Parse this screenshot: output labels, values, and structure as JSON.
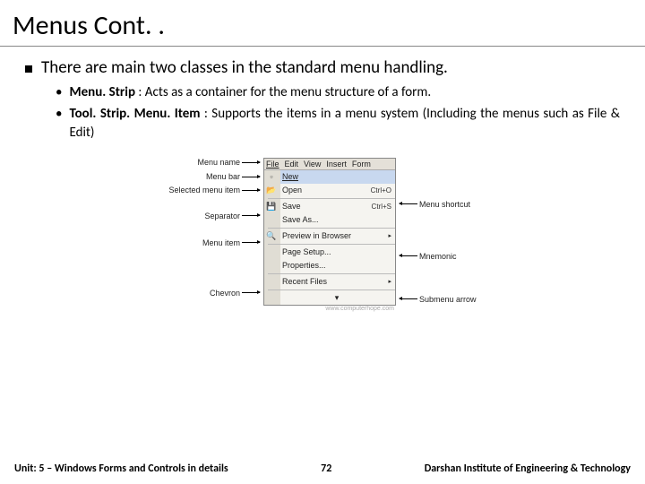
{
  "title": "Menus Cont. .",
  "bullet_main": "There are main two classes in the standard menu handling.",
  "sub1_bold": "Menu. Strip",
  "sub1_rest": " : Acts as a container for the menu structure of a form.",
  "sub2_bold": "Tool. Strip. Menu. Item",
  "sub2_rest": " : Supports the items in a menu system (Including the menus such as File & Edit)",
  "labels": {
    "menu_name": "Menu name",
    "menu_bar": "Menu bar",
    "selected": "Selected menu item",
    "separator": "Separator",
    "menu_item": "Menu item",
    "chevron": "Chevron",
    "shortcut": "Menu shortcut",
    "mnemonic": "Mnemonic",
    "submenu": "Submenu arrow"
  },
  "menubar": {
    "file": "File",
    "edit": "Edit",
    "view": "View",
    "insert": "Insert",
    "format": "Form"
  },
  "items": {
    "new": "New",
    "open": "Open",
    "open_sc": "Ctrl+O",
    "save": "Save",
    "save_sc": "Ctrl+S",
    "save_as": "Save As...",
    "preview": "Preview in Browser",
    "page_setup": "Page Setup...",
    "properties": "Properties...",
    "recent": "Recent Files"
  },
  "watermark": "www.computerhope.com",
  "footer": {
    "left": "Unit: 5 – Windows Forms and Controls in details",
    "mid": "72",
    "right": "Darshan Institute of Engineering & Technology"
  }
}
